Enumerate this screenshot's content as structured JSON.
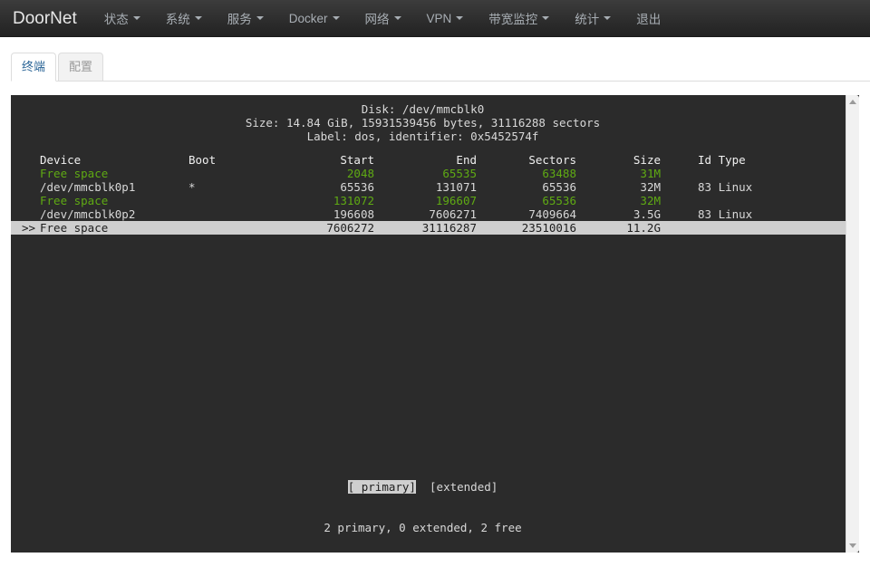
{
  "navbar": {
    "brand": "DoorNet",
    "items": [
      {
        "label": "状态",
        "has_caret": true
      },
      {
        "label": "系统",
        "has_caret": true
      },
      {
        "label": "服务",
        "has_caret": true
      },
      {
        "label": "Docker",
        "has_caret": true
      },
      {
        "label": "网络",
        "has_caret": true
      },
      {
        "label": "VPN",
        "has_caret": true
      },
      {
        "label": "带宽监控",
        "has_caret": true
      },
      {
        "label": "统计",
        "has_caret": true
      },
      {
        "label": "退出",
        "has_caret": false
      }
    ]
  },
  "tabs": [
    {
      "label": "终端",
      "active": true
    },
    {
      "label": "配置",
      "active": false
    }
  ],
  "terminal": {
    "disk_line": "Disk: /dev/mmcblk0",
    "size_line": "Size: 14.84 GiB, 15931539456 bytes, 31116288 sectors",
    "label_line": "Label: dos, identifier: 0x5452574f",
    "columns": {
      "device": "Device",
      "boot": "Boot",
      "start": "Start",
      "end": "End",
      "sectors": "Sectors",
      "size": "Size",
      "idtype": "Id Type"
    },
    "rows": [
      {
        "marker": "",
        "device": "Free space",
        "boot": "",
        "start": "2048",
        "end": "65535",
        "sectors": "63488",
        "size": "31M",
        "idtype": "",
        "free": true,
        "selected": false
      },
      {
        "marker": "",
        "device": "/dev/mmcblk0p1",
        "boot": "*",
        "start": "65536",
        "end": "131071",
        "sectors": "65536",
        "size": "32M",
        "idtype": "83 Linux",
        "free": false,
        "selected": false
      },
      {
        "marker": "",
        "device": "Free space",
        "boot": "",
        "start": "131072",
        "end": "196607",
        "sectors": "65536",
        "size": "32M",
        "idtype": "",
        "free": true,
        "selected": false
      },
      {
        "marker": "",
        "device": "/dev/mmcblk0p2",
        "boot": "",
        "start": "196608",
        "end": "7606271",
        "sectors": "7409664",
        "size": "3.5G",
        "idtype": "83 Linux",
        "free": false,
        "selected": false
      },
      {
        "marker": ">>",
        "device": "Free space",
        "boot": "",
        "start": "7606272",
        "end": "31116287",
        "sectors": "23510016",
        "size": "11.2G",
        "idtype": "",
        "free": false,
        "selected": true
      }
    ],
    "buttons": [
      {
        "label": "[ primary]",
        "selected": true
      },
      {
        "label": "[extended]",
        "selected": false
      }
    ],
    "summary": "2 primary, 0 extended, 2 free"
  },
  "colors": {
    "navbar_top": "#3c3c3c",
    "navbar_bottom": "#222222",
    "terminal_bg": "#2b2b2b",
    "terminal_fg": "#d8d8d8",
    "free_space_green": "#5faa13",
    "selection_bg": "#cfcfcf",
    "active_tab_text": "#2a6496"
  },
  "scrollbar": {
    "up_arrow": "triangle-up-icon",
    "down_arrow": "triangle-down-icon"
  }
}
